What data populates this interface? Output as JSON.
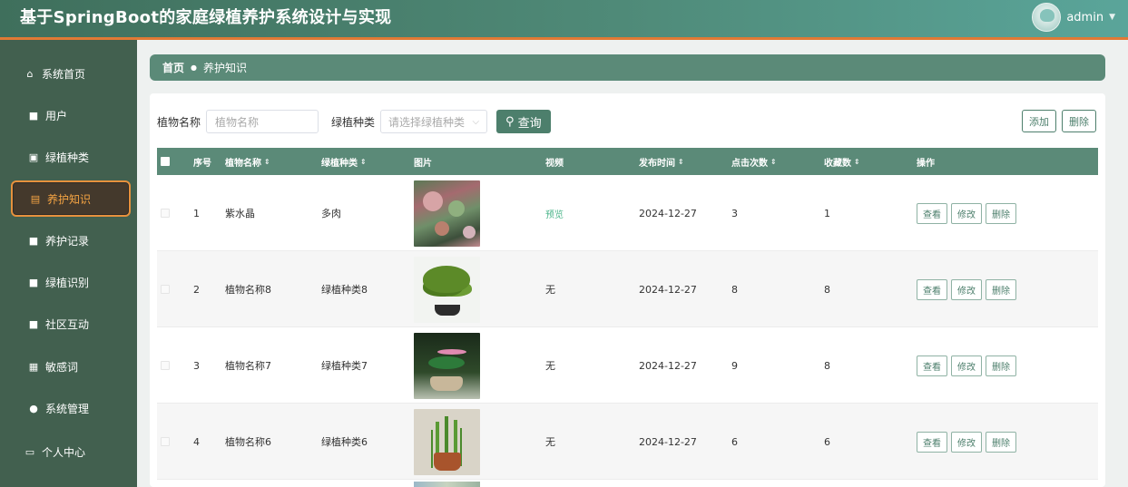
{
  "app": {
    "title": "基于SpringBoot的家庭绿植养护系统设计与实现"
  },
  "user": {
    "name": "admin"
  },
  "sidebar": {
    "items": [
      {
        "label": "系统首页",
        "icon": "home-icon"
      },
      {
        "label": "用户",
        "icon": "grid-icon"
      },
      {
        "label": "绿植种类",
        "icon": "document-icon"
      },
      {
        "label": "养护知识",
        "icon": "document-icon",
        "active": true
      },
      {
        "label": "养护记录",
        "icon": "grid-icon"
      },
      {
        "label": "绿植识别",
        "icon": "grid-icon"
      },
      {
        "label": "社区互动",
        "icon": "grid-icon"
      },
      {
        "label": "敏感词",
        "icon": "table-icon"
      },
      {
        "label": "系统管理",
        "icon": "user-icon"
      },
      {
        "label": "个人中心",
        "icon": "card-icon"
      }
    ]
  },
  "breadcrumb": {
    "home": "首页",
    "current": "养护知识"
  },
  "search": {
    "name_label": "植物名称",
    "name_placeholder": "植物名称",
    "type_label": "绿植种类",
    "type_placeholder": "请选择绿植种类",
    "query_label": "查询"
  },
  "actions": {
    "add": "添加",
    "delete": "删除"
  },
  "table": {
    "headers": {
      "index": "序号",
      "name": "植物名称",
      "type": "绿植种类",
      "image": "图片",
      "video": "视频",
      "date": "发布时间",
      "clicks": "点击次数",
      "favorites": "收藏数",
      "ops": "操作"
    },
    "rows": [
      {
        "index": "1",
        "name": "紫水晶",
        "type": "多肉",
        "video": "预览",
        "date": "2024-12-27",
        "clicks": "3",
        "favorites": "1"
      },
      {
        "index": "2",
        "name": "植物名称8",
        "type": "绿植种类8",
        "video": "无",
        "date": "2024-12-27",
        "clicks": "8",
        "favorites": "8"
      },
      {
        "index": "3",
        "name": "植物名称7",
        "type": "绿植种类7",
        "video": "无",
        "date": "2024-12-27",
        "clicks": "9",
        "favorites": "8"
      },
      {
        "index": "4",
        "name": "植物名称6",
        "type": "绿植种类6",
        "video": "无",
        "date": "2024-12-27",
        "clicks": "6",
        "favorites": "6"
      }
    ],
    "row_ops": {
      "view": "查看",
      "edit": "修改",
      "delete": "删除"
    }
  },
  "colors": {
    "primary": "#4d7f6c",
    "header_bg": "#5b8a78",
    "sidebar_bg": "#42604f",
    "active_accent": "#e6913d",
    "link": "#4bb58a"
  }
}
